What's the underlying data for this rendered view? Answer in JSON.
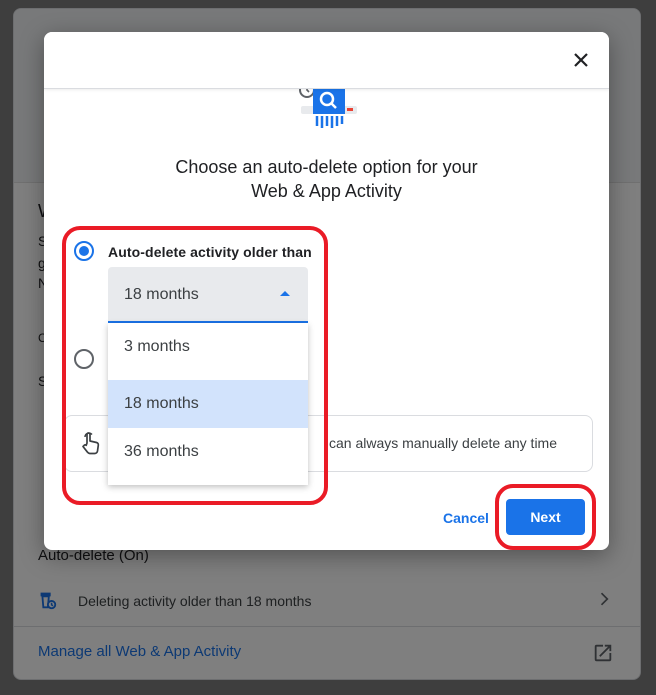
{
  "background": {
    "partial_heading": "W",
    "partial_lines": [
      "S",
      "g",
      "N",
      "C"
    ],
    "partial_section": "S",
    "auto_delete_title": "Auto-delete (On)",
    "auto_delete_row_text": "Deleting activity older than 18 months",
    "manage_link": "Manage all Web & App Activity"
  },
  "dialog": {
    "title_line1": "Choose an auto-delete option for your",
    "title_line2": "Web & App Activity",
    "option_auto_delete_label": "Auto-delete activity older than",
    "select": {
      "selected_value": "18 months",
      "options": [
        "3 months",
        "18 months",
        "36 months"
      ]
    },
    "info_text": "can always manually delete any time",
    "cancel_label": "Cancel",
    "next_label": "Next"
  },
  "colors": {
    "accent": "#1a73e8",
    "highlight": "#ea1b26",
    "selected_option_bg": "#d2e3fc"
  }
}
